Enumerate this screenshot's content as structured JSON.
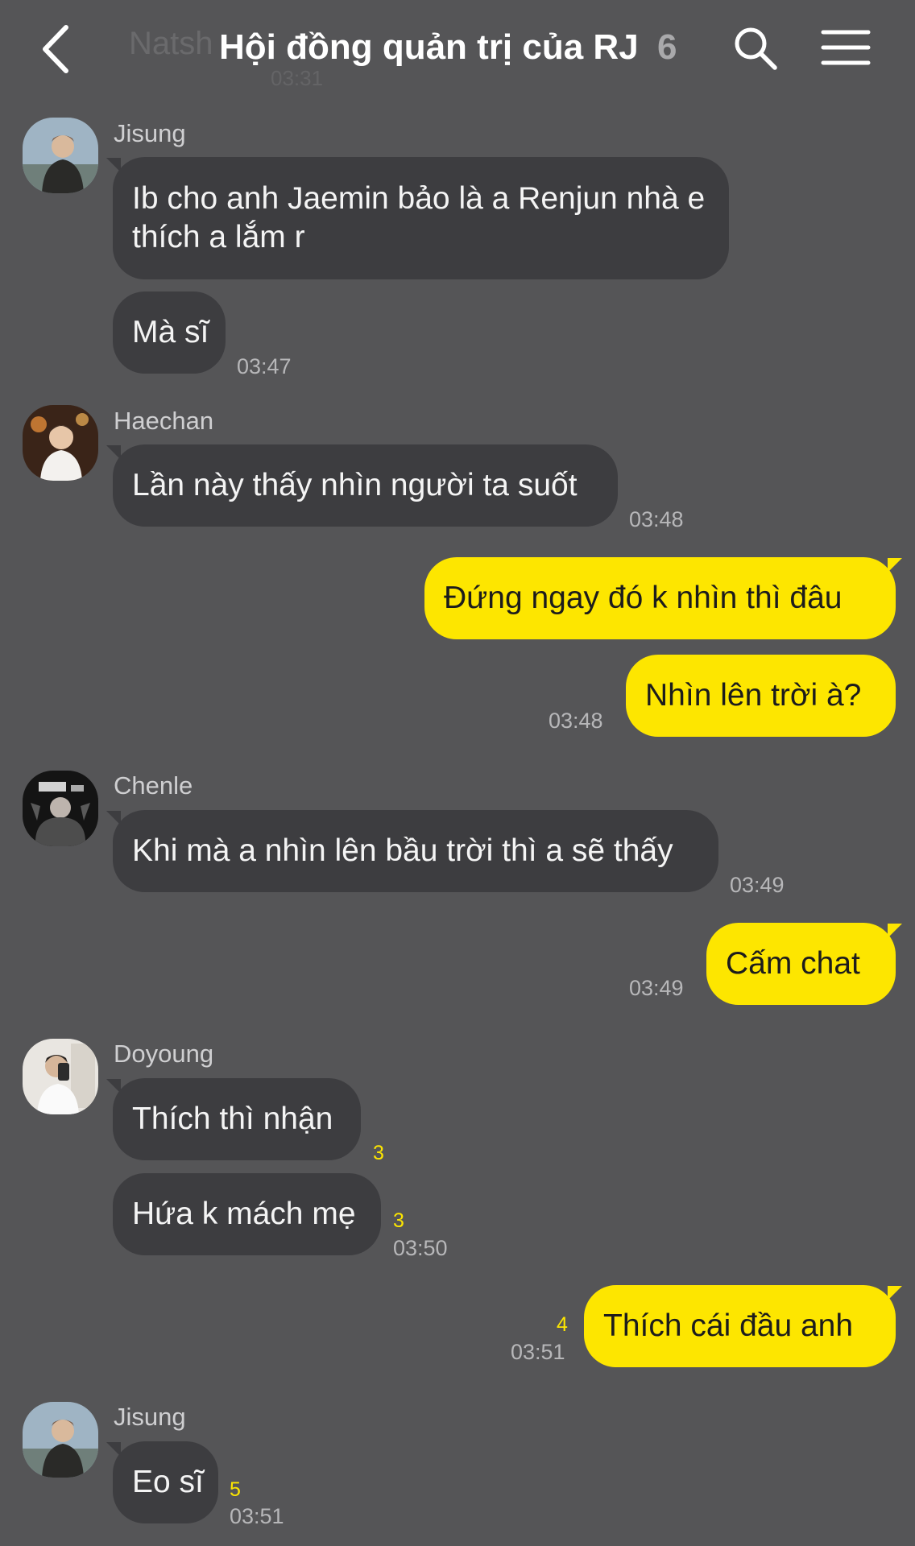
{
  "header": {
    "title": "Hội đồng quản trị của RJ",
    "member_count": "6",
    "ghost_name": "Natsh",
    "ghost_time": "03:31",
    "icons": {
      "back": "chevron-left-icon",
      "search": "search-icon",
      "menu": "hamburger-menu-icon"
    }
  },
  "messages": [
    {
      "sender": "Jisung",
      "bubbles": [
        "Ib cho anh Jaemin bảo là a Renjun nhà e thích a lắm r",
        "Mà sĩ"
      ],
      "time": "03:47"
    },
    {
      "sender": "Haechan",
      "bubbles": [
        "Lần này thấy nhìn người ta suốt"
      ],
      "time": "03:48"
    },
    {
      "sender": "me",
      "bubbles": [
        "Đứng ngay đó k nhìn thì đâu",
        "Nhìn lên trời à?"
      ],
      "time": "03:48"
    },
    {
      "sender": "Chenle",
      "bubbles": [
        "Khi mà a nhìn lên bầu trời thì a sẽ thấy"
      ],
      "time": "03:49"
    },
    {
      "sender": "me",
      "bubbles": [
        "Cấm chat"
      ],
      "time": "03:49"
    },
    {
      "sender": "Doyoung",
      "bubbles": [
        "Thích thì nhận",
        "Hứa k mách mẹ"
      ],
      "unread": [
        "3",
        "3"
      ],
      "time": "03:50"
    },
    {
      "sender": "me",
      "bubbles": [
        "Thích cái đầu anh"
      ],
      "unread": [
        "4"
      ],
      "time": "03:51"
    },
    {
      "sender": "Jisung",
      "bubbles": [
        "Eo sĩ"
      ],
      "unread": [
        "5"
      ],
      "time": "03:51"
    }
  ],
  "colors": {
    "background": "#555557",
    "incoming_bubble": "#3d3d40",
    "outgoing_bubble": "#fde600",
    "unread": "#fde600"
  }
}
